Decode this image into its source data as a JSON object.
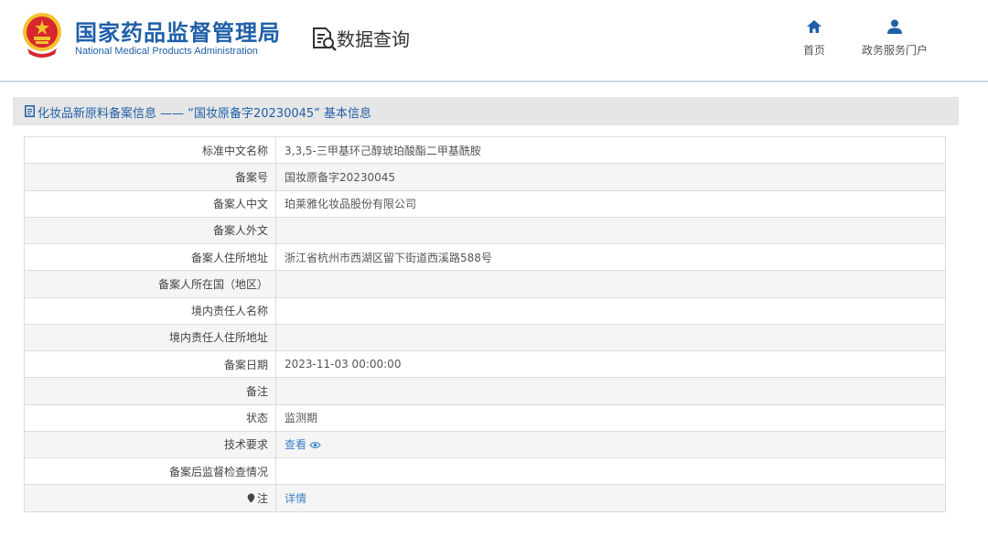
{
  "header": {
    "title_cn": "国家药品监督管理局",
    "title_en": "National Medical Products Administration",
    "page_title": "数据查询",
    "nav": [
      {
        "label": "首页",
        "icon": "home-icon"
      },
      {
        "label": "政务服务门户",
        "icon": "user-icon"
      }
    ]
  },
  "section": {
    "title": "化妆品新原料备案信息 —— “国妆原备字20230045” 基本信息",
    "icon": "document-icon"
  },
  "record": {
    "rows": [
      {
        "label": "标准中文名称",
        "value": "3,3,5-三甲基环己醇琥珀酸酯二甲基酰胺"
      },
      {
        "label": "备案号",
        "value": "国妆原备字20230045"
      },
      {
        "label": "备案人中文",
        "value": "珀莱雅化妆品股份有限公司"
      },
      {
        "label": "备案人外文",
        "value": ""
      },
      {
        "label": "备案人住所地址",
        "value": "浙江省杭州市西湖区留下街道西溪路588号"
      },
      {
        "label": "备案人所在国（地区）",
        "value": ""
      },
      {
        "label": "境内责任人名称",
        "value": ""
      },
      {
        "label": "境内责任人住所地址",
        "value": ""
      },
      {
        "label": "备案日期",
        "value": "2023-11-03 00:00:00"
      },
      {
        "label": "备注",
        "value": ""
      },
      {
        "label": "状态",
        "value": "监测期"
      },
      {
        "label": "技术要求",
        "value": "查看"
      },
      {
        "label": "备案后监督检查情况",
        "value": ""
      },
      {
        "label": "注",
        "value": "详情"
      }
    ]
  },
  "colors": {
    "brand_blue": "#1f5fa8",
    "link_blue": "#3a7fc7",
    "emblem_red": "#d7262c",
    "emblem_gold": "#f2c230"
  }
}
